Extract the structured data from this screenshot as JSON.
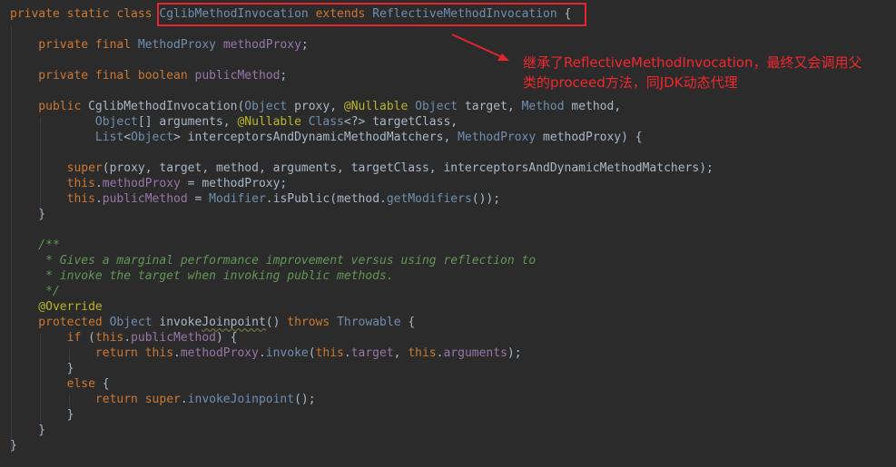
{
  "editor": {
    "lines": [
      [
        [
          "kw",
          "private static class "
        ],
        [
          "ty",
          "CglibMethodInvocation"
        ],
        [
          "kw",
          " extends "
        ],
        [
          "ty",
          "ReflectiveMethodInvocation"
        ],
        [
          "id",
          " {"
        ]
      ],
      [],
      [
        [
          "kw",
          "    private final "
        ],
        [
          "ty",
          "MethodProxy "
        ],
        [
          "fd",
          "methodProxy"
        ],
        [
          "id",
          ";"
        ]
      ],
      [],
      [
        [
          "kw",
          "    private final boolean "
        ],
        [
          "fd",
          "publicMethod"
        ],
        [
          "id",
          ";"
        ]
      ],
      [],
      [
        [
          "kw",
          "    public "
        ],
        [
          "id",
          "CglibMethodInvocation("
        ],
        [
          "ty",
          "Object"
        ],
        [
          "id",
          " proxy, "
        ],
        [
          "an",
          "@Nullable "
        ],
        [
          "ty",
          "Object"
        ],
        [
          "id",
          " target, "
        ],
        [
          "ty",
          "Method"
        ],
        [
          "id",
          " method,"
        ]
      ],
      [
        [
          "id",
          "            "
        ],
        [
          "ty",
          "Object"
        ],
        [
          "id",
          "[] arguments, "
        ],
        [
          "an",
          "@Nullable "
        ],
        [
          "ty",
          "Class"
        ],
        [
          "id",
          "<?> targetClass,"
        ]
      ],
      [
        [
          "id",
          "            "
        ],
        [
          "ty",
          "List"
        ],
        [
          "id",
          "<"
        ],
        [
          "ty",
          "Object"
        ],
        [
          "id",
          "> interceptorsAndDynamicMethodMatchers, "
        ],
        [
          "ty",
          "MethodProxy"
        ],
        [
          "id",
          " methodProxy) {"
        ]
      ],
      [],
      [
        [
          "id",
          "        "
        ],
        [
          "kw",
          "super"
        ],
        [
          "id",
          "(proxy, target, method, arguments, targetClass, interceptorsAndDynamicMethodMatchers);"
        ]
      ],
      [
        [
          "id",
          "        "
        ],
        [
          "kw",
          "this"
        ],
        [
          "id",
          "."
        ],
        [
          "fd",
          "methodProxy"
        ],
        [
          "id",
          " = methodProxy;"
        ]
      ],
      [
        [
          "id",
          "        "
        ],
        [
          "kw",
          "this"
        ],
        [
          "id",
          "."
        ],
        [
          "fd",
          "publicMethod"
        ],
        [
          "id",
          " = "
        ],
        [
          "ty",
          "Modifier"
        ],
        [
          "id",
          "."
        ],
        [
          "id",
          "isPublic(method."
        ],
        [
          "ty",
          "getModifiers"
        ],
        [
          "id",
          "());"
        ]
      ],
      [
        [
          "id",
          "    }"
        ]
      ],
      [],
      [
        [
          "cm",
          "    /**"
        ]
      ],
      [
        [
          "cm",
          "     * Gives a marginal performance improvement versus using reflection to"
        ]
      ],
      [
        [
          "cm",
          "     * invoke the target when invoking public methods."
        ]
      ],
      [
        [
          "cm",
          "     */"
        ]
      ],
      [
        [
          "an",
          "    @Override"
        ]
      ],
      [
        [
          "kw",
          "    protected "
        ],
        [
          "ty",
          "Object"
        ],
        [
          "id",
          " invoke"
        ],
        [
          "wv",
          "Joinpoint"
        ],
        [
          "id",
          "() "
        ],
        [
          "kw",
          "throws "
        ],
        [
          "ty",
          "Throwable"
        ],
        [
          "id",
          " {"
        ]
      ],
      [
        [
          "id",
          "        "
        ],
        [
          "kw",
          "if "
        ],
        [
          "id",
          "("
        ],
        [
          "kw",
          "this"
        ],
        [
          "id",
          "."
        ],
        [
          "fd",
          "publicMethod"
        ],
        [
          "id",
          ") {"
        ]
      ],
      [
        [
          "id",
          "            "
        ],
        [
          "kw",
          "return this"
        ],
        [
          "id",
          "."
        ],
        [
          "fd",
          "methodProxy"
        ],
        [
          "id",
          "."
        ],
        [
          "ty",
          "invoke"
        ],
        [
          "id",
          "("
        ],
        [
          "kw",
          "this"
        ],
        [
          "id",
          "."
        ],
        [
          "fd",
          "target"
        ],
        [
          "id",
          ", "
        ],
        [
          "kw",
          "this"
        ],
        [
          "id",
          "."
        ],
        [
          "fd",
          "arguments"
        ],
        [
          "id",
          ");"
        ]
      ],
      [
        [
          "id",
          "        }"
        ]
      ],
      [
        [
          "id",
          "        "
        ],
        [
          "kw",
          "else"
        ],
        [
          "id",
          " {"
        ]
      ],
      [
        [
          "id",
          "            "
        ],
        [
          "kw",
          "return super"
        ],
        [
          "id",
          "."
        ],
        [
          "ty",
          "invokeJoinpoint"
        ],
        [
          "id",
          "();"
        ]
      ],
      [
        [
          "id",
          "        }"
        ]
      ],
      [
        [
          "id",
          "    }"
        ]
      ],
      [
        [
          "id",
          "}"
        ]
      ]
    ]
  },
  "annotation": {
    "text": "继承了ReflectiveMethodInvocation，最终又会调用父\n类的proceed方法，同JDK动态代理",
    "color": "#f0282d"
  },
  "colors": {
    "background": "#2b2b2b",
    "keyword": "#cc7832",
    "type": "#6f8faf",
    "field": "#9876aa",
    "annotation": "#bbb529",
    "comment": "#629755",
    "highlight_box": "#e4252b"
  }
}
